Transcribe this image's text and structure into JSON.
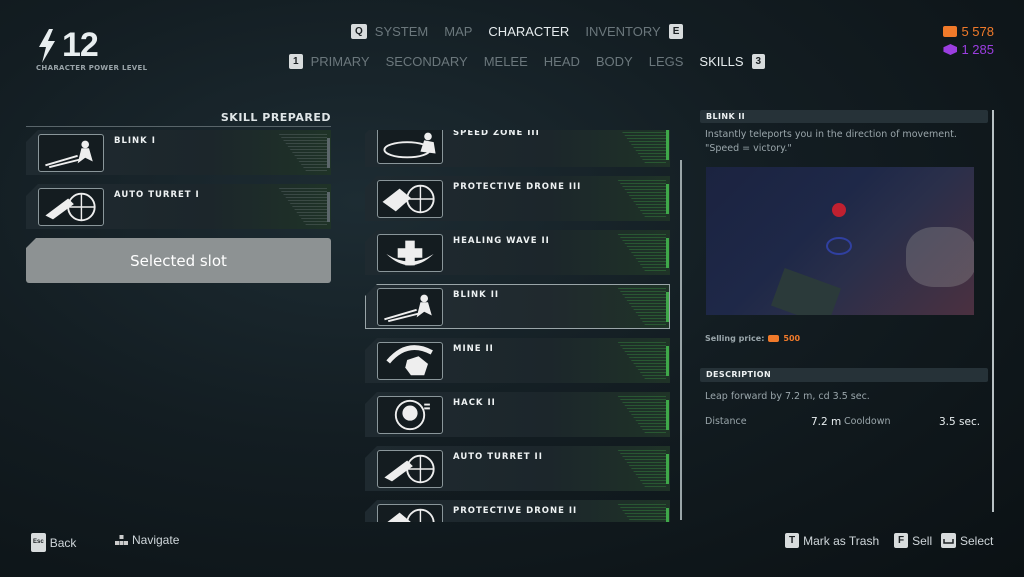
{
  "header": {
    "power_level": "12",
    "power_label": "CHARACTER POWER LEVEL",
    "main_tabs": [
      {
        "label": "SYSTEM"
      },
      {
        "label": "MAP"
      },
      {
        "label": "CHARACTER",
        "active": true
      },
      {
        "label": "INVENTORY"
      }
    ],
    "main_keys": {
      "prev": "Q",
      "next": "E"
    },
    "sub_tabs": [
      {
        "label": "PRIMARY"
      },
      {
        "label": "SECONDARY"
      },
      {
        "label": "MELEE"
      },
      {
        "label": "HEAD"
      },
      {
        "label": "BODY"
      },
      {
        "label": "LEGS"
      },
      {
        "label": "SKILLS",
        "active": true
      }
    ],
    "sub_keys": {
      "prev": "1",
      "next": "3"
    },
    "currency": [
      {
        "icon": "credits-icon",
        "value": "5 578",
        "color": "#f07a2a"
      },
      {
        "icon": "crystal-icon",
        "value": "1 285",
        "color": "#9b3ee0"
      }
    ]
  },
  "prepared": {
    "title": "SKILL PREPARED",
    "slots": [
      {
        "name": "BLINK I",
        "icon": "blink-icon"
      },
      {
        "name": "AUTO TURRET I",
        "icon": "turret-icon"
      }
    ],
    "selected_slot": "Selected slot"
  },
  "skills": [
    {
      "name": "SPEED ZONE III",
      "icon": "speed-zone-icon"
    },
    {
      "name": "PROTECTIVE DRONE III",
      "icon": "drone-icon"
    },
    {
      "name": "HEALING WAVE II",
      "icon": "healing-icon"
    },
    {
      "name": "BLINK II",
      "icon": "blink-icon",
      "selected": true
    },
    {
      "name": "MINE II",
      "icon": "mine-icon"
    },
    {
      "name": "HACK II",
      "icon": "hack-icon"
    },
    {
      "name": "AUTO TURRET II",
      "icon": "turret-icon"
    },
    {
      "name": "PROTECTIVE DRONE II",
      "icon": "drone-icon"
    }
  ],
  "detail": {
    "title": "BLINK II",
    "flavor": "Instantly teleports you in the direction of movement. \"Speed = victory.\"",
    "selling_label": "Selling price:",
    "selling_price": "500",
    "desc_title": "DESCRIPTION",
    "desc": "Leap forward by 7.2 m, cd 3.5 sec.",
    "stats": {
      "distance_label": "Distance",
      "distance": "7.2 m",
      "cooldown_label": "Cooldown",
      "cooldown": "3.5 sec."
    }
  },
  "footer": {
    "back_key": "Esc",
    "back": "Back",
    "navigate": "Navigate",
    "trash_key": "T",
    "trash": "Mark as Trash",
    "sell_key": "F",
    "sell": "Sell",
    "select": "Select"
  }
}
